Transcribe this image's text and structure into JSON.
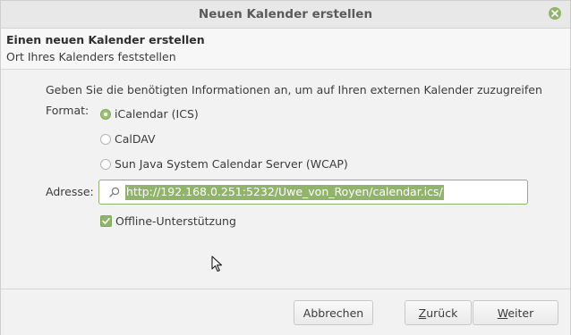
{
  "window": {
    "title": "Neuen Kalender erstellen"
  },
  "header": {
    "title": "Einen neuen Kalender erstellen",
    "subtitle": "Ort Ihres Kalenders feststellen"
  },
  "form": {
    "info_text": "Geben Sie die benötigten Informationen an, um auf Ihren externen Kalender zuzugreifen",
    "format_label": "Format:",
    "format_options": [
      {
        "label": "iCalendar (ICS)",
        "selected": true
      },
      {
        "label": "CalDAV",
        "selected": false
      },
      {
        "label": "Sun Java System Calendar Server (WCAP)",
        "selected": false
      }
    ],
    "address_label": "Adresse:",
    "address_value": "http://192.168.0.251:5232/Uwe_von_Royen/calendar.ics/",
    "offline_label": "Offline-Unterstützung",
    "offline_checked": true
  },
  "footer": {
    "cancel_label": "Abbrechen",
    "back_label_underlined": "Z",
    "back_label_rest": "urück",
    "next_label_underlined": "W",
    "next_label_rest": "eiter"
  },
  "colors": {
    "accent": "#8fb46a",
    "background": "#f2f2f2"
  }
}
